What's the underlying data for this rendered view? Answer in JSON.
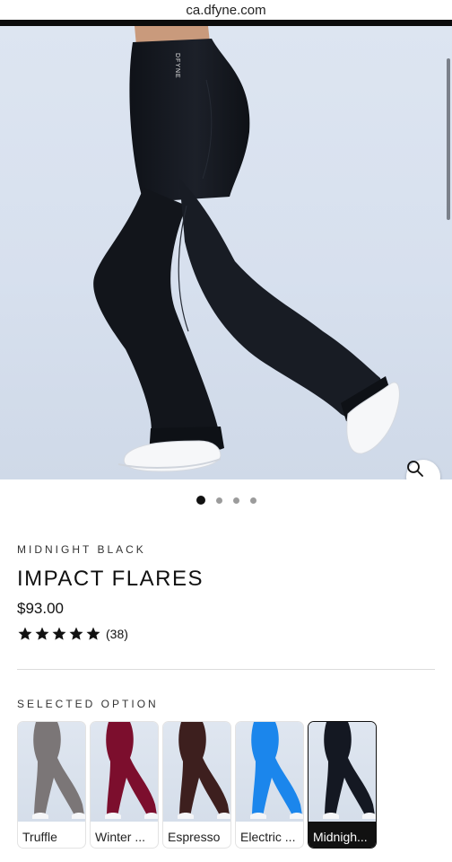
{
  "browser": {
    "url": "ca.dfyne.com"
  },
  "gallery": {
    "brand_mark": "DFYNE",
    "zoom_icon": "magnifier-icon",
    "slide_count": 4,
    "active_slide": 1
  },
  "product": {
    "color_name": "MIDNIGHT BLACK",
    "title": "IMPACT FLARES",
    "price": "$93.00",
    "rating": {
      "stars": 5,
      "count": "(38)"
    }
  },
  "options": {
    "label": "SELECTED OPTION",
    "items": [
      {
        "label": "Truffle",
        "color": "#7b7677"
      },
      {
        "label": "Winter ...",
        "color": "#7c0e2d"
      },
      {
        "label": "Espresso",
        "color": "#3d1f1e"
      },
      {
        "label": "Electric ...",
        "color": "#1b86ec"
      },
      {
        "label": "Midnigh...",
        "color": "#141822",
        "selected": true
      }
    ]
  },
  "colors": {
    "accent": "#111111",
    "hero_bg": "#d9e2ef",
    "pants": "#14171d"
  }
}
